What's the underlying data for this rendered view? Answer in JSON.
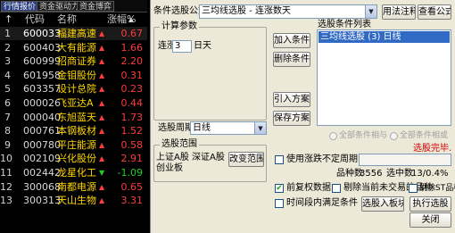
{
  "left_panel": {
    "tabs": [
      "行情报价",
      "资金驱动力",
      "资金博弈"
    ],
    "columns": {
      "rank": "↑",
      "code": "代码",
      "name": "名称",
      "change": "涨幅%",
      "marker": "▲"
    },
    "rows": [
      {
        "rank": "1",
        "code": "600033",
        "name": "福建高速",
        "change": "0.67",
        "dir": "up"
      },
      {
        "rank": "2",
        "code": "600403",
        "name": "大有能源",
        "change": "1.66",
        "dir": "up"
      },
      {
        "rank": "3",
        "code": "600999",
        "name": "招商证券",
        "change": "2.20",
        "dir": "up"
      },
      {
        "rank": "4",
        "code": "601958",
        "name": "金钼股份",
        "change": "0.31",
        "dir": "up"
      },
      {
        "rank": "5",
        "code": "603357",
        "name": "设计总院",
        "change": "0.23",
        "dir": "up"
      },
      {
        "rank": "6",
        "code": "000026",
        "name": "飞亚达A",
        "change": "0.44",
        "dir": "up"
      },
      {
        "rank": "7",
        "code": "000040",
        "name": "东旭蓝天",
        "change": "1.73",
        "dir": "up"
      },
      {
        "rank": "8",
        "code": "000761",
        "name": "本钢板材",
        "change": "1.52",
        "dir": "up"
      },
      {
        "rank": "9",
        "code": "000780",
        "name": "平庄能源",
        "change": "0.58",
        "dir": "up"
      },
      {
        "rank": "10",
        "code": "002109",
        "name": "兴化股份",
        "change": "2.91",
        "dir": "up"
      },
      {
        "rank": "11",
        "code": "002442",
        "name": "龙星化工",
        "change": "-1.09",
        "dir": "down"
      },
      {
        "rank": "12",
        "code": "300068",
        "name": "南都电源",
        "change": "0.65",
        "dir": "up"
      },
      {
        "rank": "13",
        "code": "300313",
        "name": "天山生物",
        "change": "3.31",
        "dir": "up"
      }
    ]
  },
  "dialog": {
    "formula_label": "条件选股公式",
    "formula_value": "三均线选股    - 连涨数天",
    "usage_button": "用法注释",
    "view_formula_button": "查看公式",
    "params_title": "计算参数",
    "param_label": "连涨",
    "param_value": "3",
    "param_unit": "日天",
    "add_condition_button": "加入条件",
    "delete_condition_button": "删除条件",
    "import_button": "引入方案",
    "save_button": "保存方案",
    "condition_list_title": "选股条件列表",
    "condition_list_items": [
      "三均线选股 (3) 日线"
    ],
    "period_label": "选股周期:",
    "period_value": "日线",
    "radio_and": "全部条件相与",
    "radio_or": "全部条件相或",
    "scope_title": "选股范围",
    "scope_text": "上证A股 深证A股 创业板",
    "scope_change_button": "改变范围",
    "status_text": "选股完毕.",
    "use_period_checkbox": "使用涨跌不定周期",
    "stock_count_label": "品种数",
    "stock_count_value": "3556",
    "selected_label": "选中数",
    "selected_value": "13/0.4%",
    "forward_adjust_checkbox": "前复权数据",
    "exclude_suspended_checkbox": "剔除当前未交易的品种",
    "exclude_st_checkbox": "剔除ST品种",
    "time_condition_checkbox": "时间段内满足条件",
    "select_to_block_button": "选股入板块",
    "execute_button": "执行选股",
    "close_button": "关闭"
  },
  "colors": {
    "up": "#ff3c3c",
    "down": "#22d022",
    "stock_name": "#ffd700",
    "selection": "#316ac5",
    "status": "#d40000"
  }
}
